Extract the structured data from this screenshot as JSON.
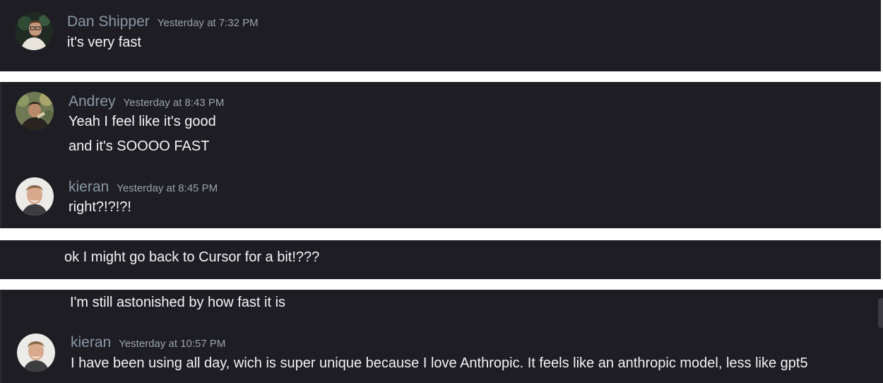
{
  "messages": [
    {
      "author": "Dan Shipper",
      "time": "Yesterday at 7:32 PM",
      "lines": [
        "it's very fast"
      ]
    },
    {
      "author": "Andrey",
      "time": "Yesterday at 8:43 PM",
      "lines": [
        "Yeah I feel like it's good",
        "and it's SOOOO FAST"
      ]
    },
    {
      "author": "kieran",
      "time": "Yesterday at 8:45 PM",
      "lines": [
        "right?!?!?!"
      ]
    },
    {
      "lines": [
        "ok I might go back to Cursor for a bit!???"
      ]
    },
    {
      "lines": [
        "I'm still astonished by how fast it is"
      ]
    },
    {
      "author": "kieran",
      "time": "Yesterday at 10:57 PM",
      "lines": [
        "I have been using all day, wich is super unique because I love Anthropic. It feels like an anthropic model, less like gpt5"
      ]
    }
  ],
  "icons": {
    "dan_avatar": "avatar-dan-shipper",
    "andrey_avatar": "avatar-andrey",
    "kieran_avatar": "avatar-kieran"
  },
  "colors": {
    "background": "#1e1d24",
    "author": "#8a98a6",
    "text": "#f4f4f6",
    "timestamp": "#9aa3ac"
  }
}
